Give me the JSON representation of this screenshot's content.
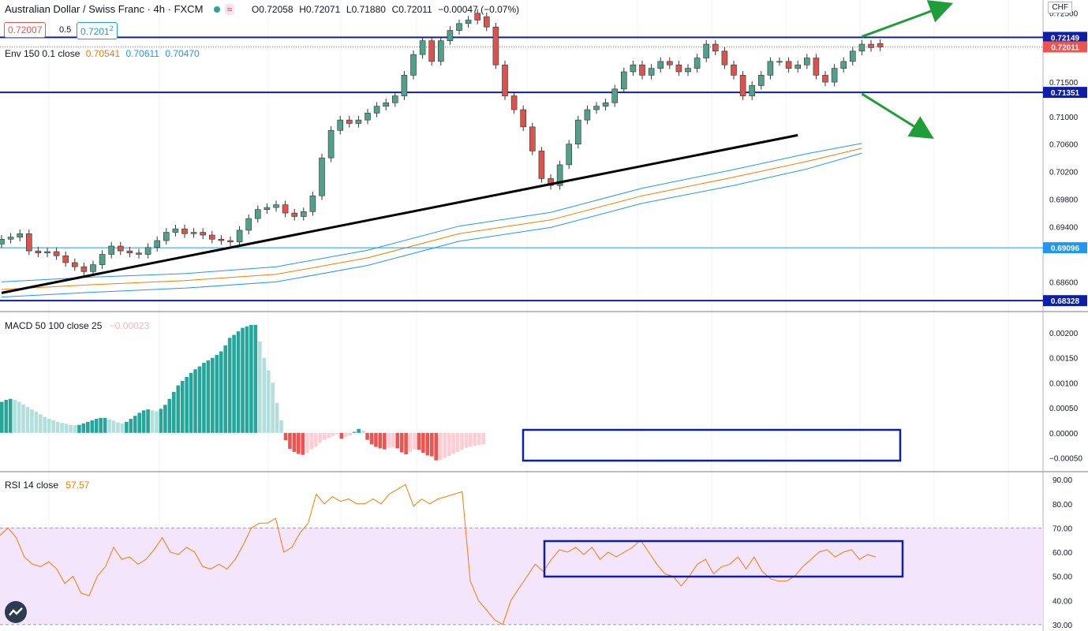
{
  "header": {
    "symbol": "Australian Dollar / Swiss Franc · 4h · FXCM",
    "ohlc": {
      "o": "O0.72058",
      "h": "H0.72071",
      "l": "L0.71880",
      "c": "C0.72011",
      "chg": "−0.00047 (−0.07%)"
    },
    "bid": "0.72007",
    "spread": "0.5",
    "ask": "0.7201",
    "ask_suffix": "2",
    "currency": "CHF"
  },
  "indicators": {
    "env": {
      "label": "Env 150 0.1 close",
      "v1": "0.70541",
      "v2": "0.70611",
      "v3": "0.70470"
    },
    "macd": {
      "label": "MACD 50 100 close 25",
      "value": "−0.00023"
    },
    "rsi": {
      "label": "RSI 14 close",
      "value": "57.57"
    }
  },
  "colors": {
    "up": "#26a69a",
    "down": "#ef5350",
    "candle_up": "#53a08a",
    "candle_down": "#d9534f",
    "hline": "#0d1fa8",
    "env_upper": "#2196f3",
    "env_mid": "#f57c00",
    "env_lower": "#2196f3",
    "rsi_line": "#f57c00",
    "rsi_band": "#f3e5fb",
    "arrow": "#1e9e36",
    "macd_up_dark": "#26a69a",
    "macd_up_light": "#b2dfdb",
    "macd_dn_dark": "#ef5350",
    "macd_dn_light": "#ffcdd2"
  },
  "chart_data": [
    {
      "type": "candlestick",
      "name": "price",
      "ylim": [
        0.6825,
        0.726
      ],
      "yticks": [
        "0.72500",
        "0.71500",
        "0.71000",
        "0.70600",
        "0.70200",
        "0.69800",
        "0.69400",
        "0.68600"
      ],
      "horizontal_lines": [
        {
          "value": 0.72149,
          "label": "0.72149"
        },
        {
          "value": 0.71351,
          "label": "0.71351"
        },
        {
          "value": 0.69096,
          "label": "0.69096"
        },
        {
          "value": 0.68328,
          "label": "0.68328"
        }
      ],
      "last_price": {
        "value": 0.72011,
        "label": "0.72011"
      },
      "trendline": {
        "from": [
          0,
          0.6844
        ],
        "to": [
          87,
          0.7073
        ]
      },
      "arrows": [
        {
          "from": [
            94,
            0.7216
          ],
          "to": [
            103,
            0.726
          ],
          "direction": "up"
        },
        {
          "from": [
            94,
            0.7133
          ],
          "to": [
            101,
            0.7075
          ],
          "direction": "down"
        }
      ],
      "env_mid": [
        [
          0,
          0.6849
        ],
        [
          10,
          0.6856
        ],
        [
          20,
          0.6862
        ],
        [
          30,
          0.6871
        ],
        [
          40,
          0.6895
        ],
        [
          50,
          0.693
        ],
        [
          60,
          0.695
        ],
        [
          70,
          0.6985
        ],
        [
          80,
          0.7012
        ],
        [
          88,
          0.7035
        ],
        [
          94,
          0.7054
        ]
      ],
      "env_upper": [
        [
          0,
          0.686
        ],
        [
          10,
          0.6867
        ],
        [
          20,
          0.6872
        ],
        [
          30,
          0.6882
        ],
        [
          40,
          0.6906
        ],
        [
          50,
          0.6941
        ],
        [
          60,
          0.6961
        ],
        [
          70,
          0.6996
        ],
        [
          80,
          0.7023
        ],
        [
          88,
          0.7046
        ],
        [
          94,
          0.7061
        ]
      ],
      "env_lower": [
        [
          0,
          0.6838
        ],
        [
          10,
          0.6845
        ],
        [
          20,
          0.6851
        ],
        [
          30,
          0.686
        ],
        [
          40,
          0.6884
        ],
        [
          50,
          0.6919
        ],
        [
          60,
          0.6939
        ],
        [
          70,
          0.6974
        ],
        [
          80,
          0.7
        ],
        [
          88,
          0.7024
        ],
        [
          94,
          0.7047
        ]
      ],
      "candles_close": [
        0.6922,
        0.6925,
        0.693,
        0.6905,
        0.6902,
        0.6904,
        0.6898,
        0.6888,
        0.6882,
        0.6875,
        0.6885,
        0.69,
        0.6912,
        0.6905,
        0.6902,
        0.69,
        0.691,
        0.692,
        0.6932,
        0.6937,
        0.693,
        0.6932,
        0.6928,
        0.6922,
        0.692,
        0.6918,
        0.6935,
        0.6952,
        0.6965,
        0.6968,
        0.6972,
        0.696,
        0.6955,
        0.6962,
        0.6985,
        0.704,
        0.708,
        0.7095,
        0.709,
        0.7095,
        0.7105,
        0.7115,
        0.712,
        0.713,
        0.716,
        0.719,
        0.721,
        0.718,
        0.721,
        0.7225,
        0.7235,
        0.724,
        0.724,
        0.723,
        0.7175,
        0.713,
        0.711,
        0.7085,
        0.705,
        0.701,
        0.7,
        0.703,
        0.706,
        0.7095,
        0.711,
        0.7115,
        0.712,
        0.714,
        0.7165,
        0.7175,
        0.716,
        0.717,
        0.718,
        0.7175,
        0.7165,
        0.717,
        0.7185,
        0.7205,
        0.7195,
        0.7175,
        0.716,
        0.713,
        0.7145,
        0.716,
        0.718,
        0.718,
        0.717,
        0.7175,
        0.7185,
        0.716,
        0.715,
        0.717,
        0.718,
        0.7195,
        0.7205,
        0.72,
        0.7201
      ],
      "candles_open": [
        0.6915,
        0.6922,
        0.6925,
        0.693,
        0.6905,
        0.6902,
        0.6904,
        0.6898,
        0.6888,
        0.6882,
        0.6875,
        0.6885,
        0.69,
        0.6912,
        0.6905,
        0.6902,
        0.69,
        0.691,
        0.692,
        0.6932,
        0.6937,
        0.693,
        0.6932,
        0.6928,
        0.6922,
        0.692,
        0.6918,
        0.6935,
        0.6952,
        0.6965,
        0.6968,
        0.6972,
        0.696,
        0.6955,
        0.6962,
        0.6985,
        0.704,
        0.708,
        0.7095,
        0.709,
        0.7095,
        0.7105,
        0.7115,
        0.712,
        0.713,
        0.716,
        0.719,
        0.721,
        0.718,
        0.721,
        0.7225,
        0.7235,
        0.725,
        0.7245,
        0.723,
        0.7175,
        0.713,
        0.711,
        0.7085,
        0.705,
        0.701,
        0.7,
        0.703,
        0.706,
        0.7095,
        0.711,
        0.7115,
        0.712,
        0.714,
        0.7165,
        0.7175,
        0.716,
        0.717,
        0.718,
        0.7175,
        0.7165,
        0.717,
        0.7185,
        0.7205,
        0.7195,
        0.7175,
        0.716,
        0.713,
        0.7145,
        0.716,
        0.718,
        0.718,
        0.717,
        0.7175,
        0.7185,
        0.716,
        0.715,
        0.717,
        0.718,
        0.7195,
        0.7205,
        0.7206
      ]
    },
    {
      "type": "bar",
      "name": "macd_histogram",
      "ylim": [
        -0.00065,
        0.0023
      ],
      "yticks": [
        "0.00200",
        "0.00150",
        "0.00100",
        "0.00050",
        "0.00000",
        "−0.00050"
      ],
      "values": [
        0.00062,
        0.00066,
        0.00068,
        0.00066,
        0.00062,
        0.00057,
        0.00052,
        0.00047,
        0.00042,
        0.00037,
        0.00032,
        0.00028,
        0.00025,
        0.00022,
        0.0002,
        0.00018,
        0.00016,
        0.00015,
        0.00016,
        0.00019,
        0.00022,
        0.00025,
        0.00028,
        0.0003,
        0.0003,
        0.00027,
        0.00024,
        0.00021,
        0.00019,
        0.00022,
        0.00028,
        0.00034,
        0.0004,
        0.00045,
        0.00047,
        0.00045,
        0.00043,
        0.00048,
        0.00056,
        0.00068,
        0.00082,
        0.00095,
        0.00104,
        0.00112,
        0.0012,
        0.00127,
        0.00133,
        0.0014,
        0.00145,
        0.0015,
        0.00156,
        0.00163,
        0.00175,
        0.0019,
        0.00196,
        0.00203,
        0.0021,
        0.00213,
        0.00216,
        0.00216,
        0.00183,
        0.0015,
        0.00125,
        0.001,
        0.0006,
        0.00025,
        -0.00015,
        -0.00032,
        -0.00038,
        -0.00042,
        -0.00044,
        -0.0004,
        -0.00033,
        -0.00028,
        -0.0002,
        -0.00014,
        -0.0001,
        -6e-05,
        -3e-05,
        -0.00012,
        -8e-05,
        -5e-05,
        2e-05,
        8e-05,
        4e-05,
        -0.00014,
        -0.00023,
        -0.00028,
        -0.00031,
        -0.00033,
        -0.0003,
        -0.00029,
        -0.00031,
        -0.00039,
        -0.00043,
        -0.00038,
        -0.00033,
        -0.00034,
        -0.0004,
        -0.00045,
        -0.00047,
        -0.00055,
        -0.00054,
        -0.0005,
        -0.00046,
        -0.00042,
        -0.00038,
        -0.00034,
        -0.0003,
        -0.00028,
        -0.00026,
        -0.00024,
        -0.00023
      ]
    },
    {
      "type": "line",
      "name": "rsi",
      "ylim": [
        28,
        92
      ],
      "band": [
        30,
        70
      ],
      "yticks": [
        "90.00",
        "80.00",
        "70.00",
        "60.00",
        "50.00",
        "40.00",
        "30.00"
      ],
      "values": [
        67,
        70,
        66,
        58,
        55,
        54,
        56,
        53,
        47,
        50,
        43,
        42,
        50,
        54,
        62,
        57,
        58,
        55,
        57,
        61,
        66,
        60,
        59,
        62,
        60,
        54,
        53,
        55,
        53,
        57,
        63,
        70,
        72,
        72,
        74,
        60,
        62,
        68,
        72,
        84,
        80,
        83,
        81,
        82,
        80,
        80,
        82,
        80,
        84,
        86,
        88,
        79,
        82,
        80,
        82,
        83,
        84,
        85,
        48,
        40,
        36,
        32,
        30,
        40,
        45,
        50,
        55,
        52,
        57,
        61,
        60,
        62,
        59,
        62,
        57,
        60,
        58,
        60,
        62,
        65,
        60,
        55,
        51,
        50,
        46,
        50,
        55,
        57,
        51,
        54,
        55,
        58,
        53,
        58,
        52,
        49,
        48,
        48,
        50,
        54,
        57,
        60,
        61,
        58,
        60,
        61,
        57,
        59,
        58
      ]
    }
  ]
}
